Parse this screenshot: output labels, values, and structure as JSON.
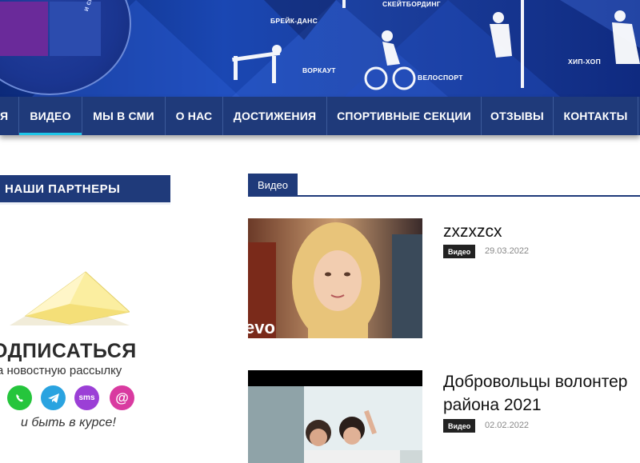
{
  "banner": {
    "labels": [
      "БРЕЙК-ДАНС",
      "СКЕЙТБОРДИНГ",
      "ВОРКАУТ",
      "ВЕЛОСПОРТ",
      "ХИП-ХОП"
    ],
    "logo_text": "и спорта • цент"
  },
  "nav": {
    "items": [
      {
        "label": "Я"
      },
      {
        "label": "ВИДЕО",
        "active": true
      },
      {
        "label": "МЫ В СМИ"
      },
      {
        "label": "О НАС"
      },
      {
        "label": "ДОСТИЖЕНИЯ"
      },
      {
        "label": "СПОРТИВНЫЕ СЕКЦИИ"
      },
      {
        "label": "ОТЗЫВЫ"
      },
      {
        "label": "КОНТАКТЫ"
      }
    ]
  },
  "sidebar": {
    "partners_title": "НАШИ ПАРТНЕРЫ",
    "subscribe": {
      "title": "ОДПИСАТЬСЯ",
      "subtitle": "а новостную рассылку",
      "icons": [
        "whatsapp-icon",
        "telegram-icon",
        "sms-icon",
        "email-icon"
      ],
      "sms_label": "sms",
      "at_label": "@",
      "footer": "и быть в курсе!"
    }
  },
  "main": {
    "section_title": "Видео",
    "posts": [
      {
        "title": "zxzxzcx",
        "category": "Видео",
        "date": "29.03.2022",
        "thumb_overlay": "evo"
      },
      {
        "title_line1": "Добровольцы волонтер",
        "title_line2": "района 2021",
        "category": "Видео",
        "date": "02.02.2022"
      }
    ]
  },
  "colors": {
    "nav_bg": "#1f3a7a",
    "active_underline": "#1ec6e8",
    "badge_bg": "#222222",
    "whatsapp": "#25c53c",
    "telegram": "#2aa3e0",
    "sms": "#9b3fd6",
    "email": "#d93aa0"
  }
}
